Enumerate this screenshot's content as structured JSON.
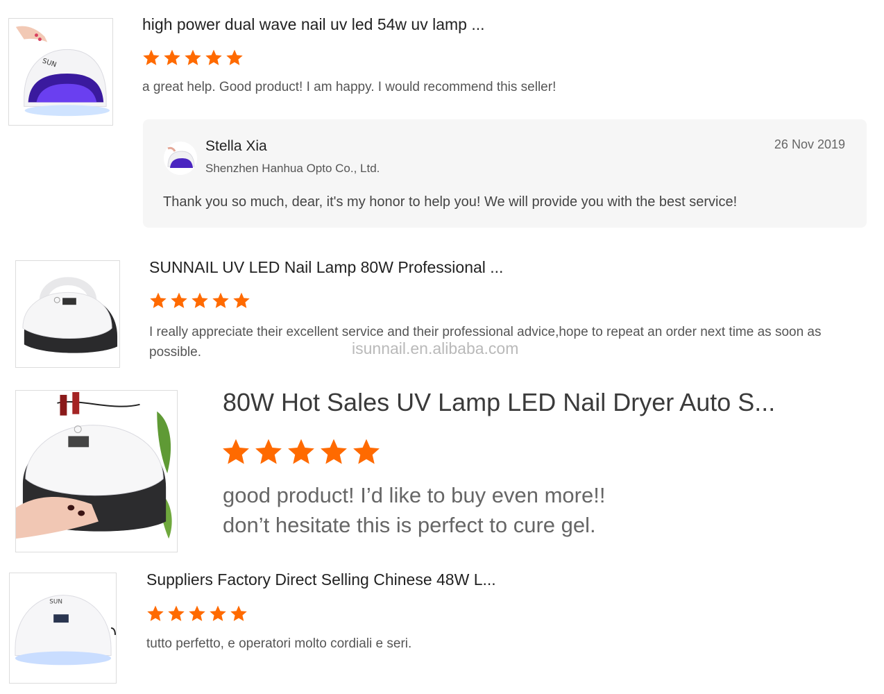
{
  "colors": {
    "star": "#ff6a00",
    "reply_bg": "#f6f6f6",
    "watermark": "#b9b9b9"
  },
  "icons": {
    "rating": "star-icon"
  },
  "reviews": [
    {
      "title": "high power dual wave nail uv led 54w uv lamp ...",
      "rating": 5,
      "text": "a great help. Good product! I am happy. I would recommend this seller!",
      "reply": {
        "name": "Stella Xia",
        "company": "Shenzhen Hanhua Opto Co., Ltd.",
        "date": "26 Nov 2019",
        "text": "Thank you so much, dear, it's my honor to help you! We will provide you with the best service!"
      }
    },
    {
      "title": "SUNNAIL UV LED Nail Lamp 80W Professional ...",
      "rating": 5,
      "text": "I really appreciate their excellent service and their professional advice,hope to repeat an order next time as soon as possible."
    },
    {
      "title": "80W Hot Sales UV Lamp LED Nail Dryer Auto S...",
      "rating": 5,
      "text_line1": "good product! I’d like to buy even more!!",
      "text_line2": "don’t hesitate this is perfect to cure gel."
    },
    {
      "title": "Suppliers Factory Direct Selling Chinese 48W L...",
      "rating": 5,
      "text": "tutto perfetto, e operatori molto cordiali e seri."
    }
  ],
  "watermark": "isunnail.en.alibaba.com"
}
